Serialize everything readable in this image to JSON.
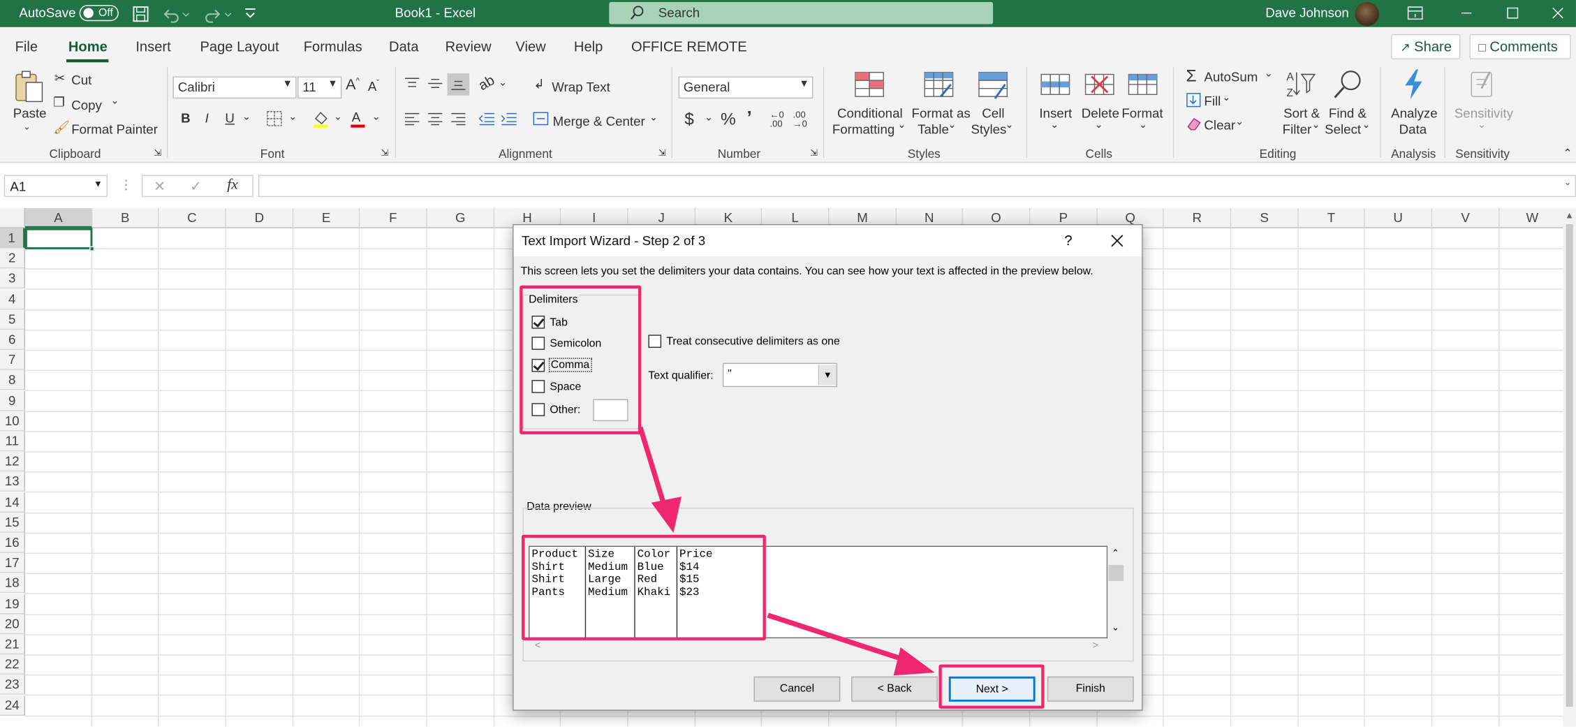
{
  "titlebar": {
    "autosave": "AutoSave",
    "toggle": "Off",
    "doc": "Book1  -  Excel",
    "search": "Search",
    "user": "Dave Johnson"
  },
  "tabs": [
    "File",
    "Home",
    "Insert",
    "Page Layout",
    "Formulas",
    "Data",
    "Review",
    "View",
    "Help",
    "OFFICE REMOTE"
  ],
  "share": "Share",
  "comments": "Comments",
  "ribbon": {
    "paste": "Paste",
    "cut": "Cut",
    "copy": "Copy",
    "format_painter": "Format Painter",
    "clipboard": "Clipboard",
    "font_name": "Calibri",
    "font_size": "11",
    "font": "Font",
    "wrap_text": "Wrap Text",
    "merge_center": "Merge & Center",
    "alignment": "Alignment",
    "number_format": "General",
    "number": "Number",
    "cond_fmt": "Conditional",
    "cond_fmt2": "Formatting",
    "fmt_table": "Format as",
    "fmt_table2": "Table",
    "cell_styles": "Cell",
    "cell_styles2": "Styles",
    "styles": "Styles",
    "insert": "Insert",
    "delete": "Delete",
    "format": "Format",
    "cells": "Cells",
    "autosum": "AutoSum",
    "fill": "Fill",
    "clear": "Clear",
    "sort": "Sort &",
    "sort2": "Filter",
    "find": "Find &",
    "find2": "Select",
    "editing": "Editing",
    "analyze": "Analyze",
    "analyze2": "Data",
    "analysis": "Analysis",
    "sensitivity": "Sensitivity",
    "sensitivity_grp": "Sensitivity"
  },
  "namebox": "A1",
  "columns": [
    "A",
    "B",
    "C",
    "D",
    "E",
    "F",
    "G",
    "H",
    "I",
    "J",
    "K",
    "L",
    "M",
    "N",
    "O",
    "P",
    "Q",
    "R",
    "S",
    "T",
    "U",
    "V",
    "W"
  ],
  "rows": [
    "1",
    "2",
    "3",
    "4",
    "5",
    "6",
    "7",
    "8",
    "9",
    "10",
    "11",
    "12",
    "13",
    "14",
    "15",
    "16",
    "17",
    "18",
    "19",
    "20",
    "21",
    "22",
    "23",
    "24"
  ],
  "dialog": {
    "title": "Text Import Wizard - Step 2 of 3",
    "help": "?",
    "intro": "This screen lets you set the delimiters your data contains.  You can see how your text is affected in the preview below.",
    "delimiters_label": "Delimiters",
    "delimiters": [
      {
        "label": "Tab",
        "checked": true
      },
      {
        "label": "Semicolon",
        "checked": false
      },
      {
        "label": "Comma",
        "checked": true
      },
      {
        "label": "Space",
        "checked": false
      },
      {
        "label": "Other:",
        "checked": false
      }
    ],
    "consecutive": "Treat consecutive delimiters as one",
    "qualifier_label": "Text qualifier:",
    "qualifier_value": "\"",
    "preview_label": "Data preview",
    "preview_columns": [
      [
        "Product",
        "Shirt",
        "Shirt",
        "Pants"
      ],
      [
        "Size",
        "Medium",
        "Large",
        "Medium"
      ],
      [
        "Color",
        "Blue",
        "Red",
        "Khaki"
      ],
      [
        "Price",
        "$14",
        "$15",
        "$23"
      ]
    ],
    "buttons": {
      "cancel": "Cancel",
      "back": "< Back",
      "next": "Next >",
      "finish": "Finish"
    }
  },
  "colors": {
    "excel_green": "#217346",
    "annotation": "#f0266f"
  }
}
